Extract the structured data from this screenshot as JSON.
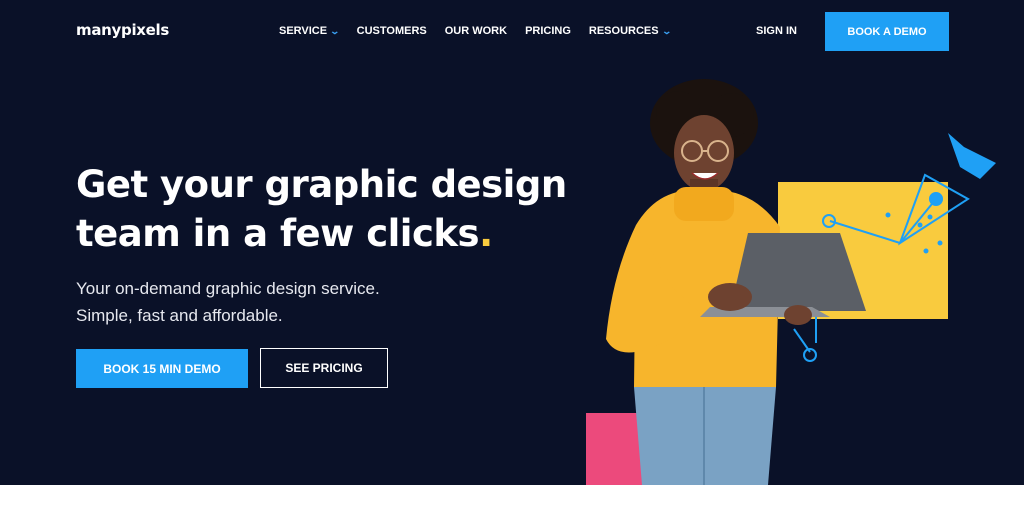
{
  "header": {
    "logo": "manypixels",
    "nav": [
      {
        "label": "SERVICE",
        "dropdown": true
      },
      {
        "label": "CUSTOMERS",
        "dropdown": false
      },
      {
        "label": "OUR WORK",
        "dropdown": false
      },
      {
        "label": "PRICING",
        "dropdown": false
      },
      {
        "label": "RESOURCES",
        "dropdown": true
      }
    ],
    "sign_in": "SIGN IN",
    "book_demo": "BOOK A DEMO"
  },
  "hero": {
    "headline_line1": "Get your graphic design",
    "headline_line2": "team in a few clicks",
    "headline_dot": ".",
    "subtitle_line1": "Your on-demand graphic design service.",
    "subtitle_line2": "Simple, fast and affordable.",
    "primary_button": "BOOK 15 MIN DEMO",
    "secondary_button": "SEE PRICING"
  },
  "icons": {
    "dropdown": "chevron-down-icon",
    "illustration": "woman-with-laptop",
    "pen_tool": "pen-tool-icon"
  },
  "colors": {
    "background": "#0a1128",
    "accent_blue": "#1fa0f5",
    "accent_yellow": "#f9cb3e",
    "accent_pink": "#ec4a7c"
  }
}
